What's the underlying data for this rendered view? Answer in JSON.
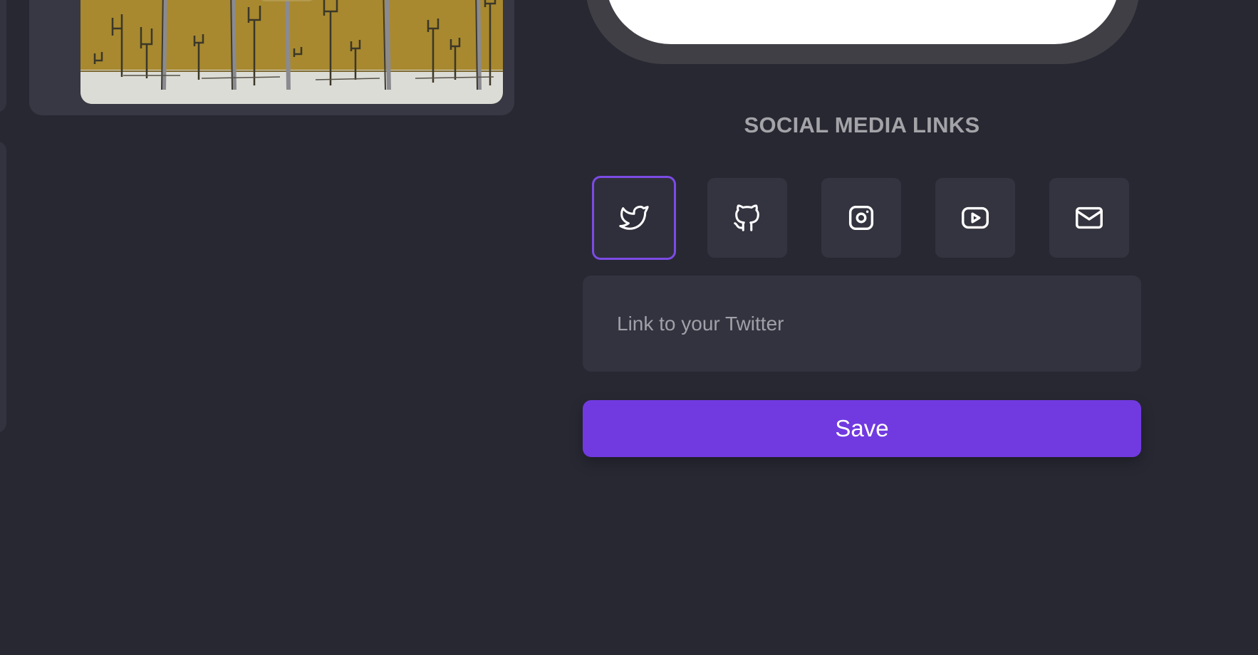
{
  "section": {
    "title": "SOCIAL MEDIA LINKS"
  },
  "social_buttons": [
    {
      "name": "twitter",
      "icon": "twitter-icon",
      "active": true
    },
    {
      "name": "github",
      "icon": "github-icon",
      "active": false
    },
    {
      "name": "instagram",
      "icon": "instagram-icon",
      "active": false
    },
    {
      "name": "youtube",
      "icon": "youtube-icon",
      "active": false
    },
    {
      "name": "email",
      "icon": "mail-icon",
      "active": false
    }
  ],
  "link_input": {
    "placeholder": "Link to your Twitter",
    "value": ""
  },
  "save_button": {
    "label": "Save"
  },
  "colors": {
    "background": "#282833",
    "accent": "#713ae0",
    "active_border": "#7c4be6",
    "card": "#343440",
    "title": "#a3a3a8"
  }
}
